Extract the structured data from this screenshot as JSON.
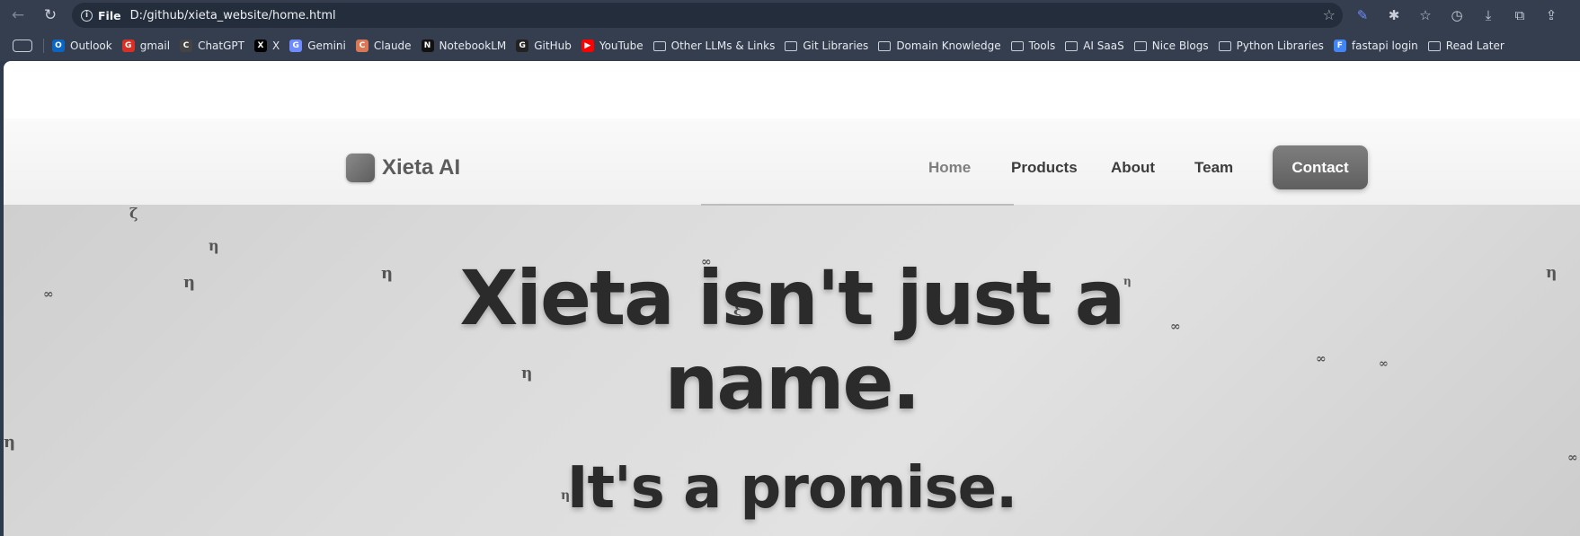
{
  "browser": {
    "url_scheme": "File",
    "url": "D:/github/xieta_website/home.html",
    "bookmarks": [
      {
        "label": "Outlook",
        "icon": "outlook-icon",
        "color": "#0a66c2"
      },
      {
        "label": "gmail",
        "icon": "gmail-icon",
        "color": "#d93025"
      },
      {
        "label": "ChatGPT",
        "icon": "chatgpt-icon",
        "color": "#444444"
      },
      {
        "label": "X",
        "icon": "x-icon",
        "color": "#000000"
      },
      {
        "label": "Gemini",
        "icon": "gemini-icon",
        "color": "#6e8bff"
      },
      {
        "label": "Claude",
        "icon": "claude-icon",
        "color": "#d97757"
      },
      {
        "label": "NotebookLM",
        "icon": "notebooklm-icon",
        "color": "#111111"
      },
      {
        "label": "GitHub",
        "icon": "github-icon",
        "color": "#222222"
      },
      {
        "label": "YouTube",
        "icon": "youtube-icon",
        "color": "#ff0000"
      },
      {
        "label": "Other LLMs & Links",
        "icon": "folder-icon"
      },
      {
        "label": "Git Libraries",
        "icon": "folder-icon"
      },
      {
        "label": "Domain Knowledge",
        "icon": "folder-icon"
      },
      {
        "label": "Tools",
        "icon": "folder-icon"
      },
      {
        "label": "AI SaaS",
        "icon": "folder-icon"
      },
      {
        "label": "Nice Blogs",
        "icon": "folder-icon"
      },
      {
        "label": "Python Libraries",
        "icon": "folder-icon"
      },
      {
        "label": "fastapi login",
        "icon": "google-icon",
        "color": "#4285f4"
      },
      {
        "label": "Read Later",
        "icon": "folder-icon"
      }
    ]
  },
  "site": {
    "logo_text": "Xieta AI",
    "nav": {
      "home": "Home",
      "products": "Products",
      "about": "About",
      "team": "Team",
      "contact": "Contact"
    },
    "hero": {
      "line1": "Xieta isn't just a",
      "line2": "name.",
      "sub": "It's a promise."
    },
    "glyphs": [
      "ζ",
      "η",
      "η",
      "η",
      "∞",
      "η",
      "∞",
      "ξ",
      "∞",
      "∞",
      "∞",
      "η",
      "η",
      "η",
      "∞",
      "ξ",
      "∞",
      "η"
    ]
  },
  "colors": {
    "browser_bg": "#343e4f",
    "contact_button": "#6e6e6e",
    "headline": "#2b2b2b"
  }
}
